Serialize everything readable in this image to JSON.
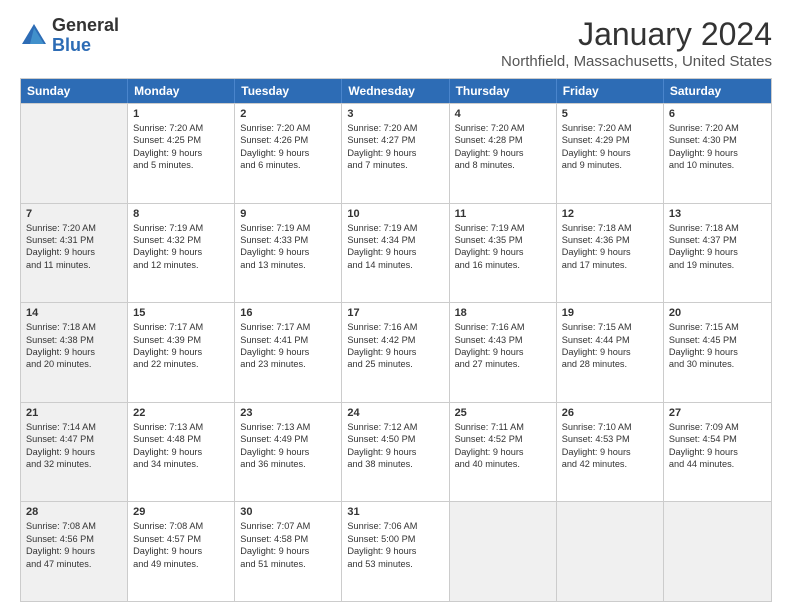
{
  "logo": {
    "general": "General",
    "blue": "Blue"
  },
  "title": {
    "month": "January 2024",
    "location": "Northfield, Massachusetts, United States"
  },
  "header_days": [
    "Sunday",
    "Monday",
    "Tuesday",
    "Wednesday",
    "Thursday",
    "Friday",
    "Saturday"
  ],
  "weeks": [
    [
      {
        "day": "",
        "lines": [],
        "shaded": true
      },
      {
        "day": "1",
        "lines": [
          "Sunrise: 7:20 AM",
          "Sunset: 4:25 PM",
          "Daylight: 9 hours",
          "and 5 minutes."
        ],
        "shaded": false
      },
      {
        "day": "2",
        "lines": [
          "Sunrise: 7:20 AM",
          "Sunset: 4:26 PM",
          "Daylight: 9 hours",
          "and 6 minutes."
        ],
        "shaded": false
      },
      {
        "day": "3",
        "lines": [
          "Sunrise: 7:20 AM",
          "Sunset: 4:27 PM",
          "Daylight: 9 hours",
          "and 7 minutes."
        ],
        "shaded": false
      },
      {
        "day": "4",
        "lines": [
          "Sunrise: 7:20 AM",
          "Sunset: 4:28 PM",
          "Daylight: 9 hours",
          "and 8 minutes."
        ],
        "shaded": false
      },
      {
        "day": "5",
        "lines": [
          "Sunrise: 7:20 AM",
          "Sunset: 4:29 PM",
          "Daylight: 9 hours",
          "and 9 minutes."
        ],
        "shaded": false
      },
      {
        "day": "6",
        "lines": [
          "Sunrise: 7:20 AM",
          "Sunset: 4:30 PM",
          "Daylight: 9 hours",
          "and 10 minutes."
        ],
        "shaded": false
      }
    ],
    [
      {
        "day": "7",
        "lines": [
          "Sunrise: 7:20 AM",
          "Sunset: 4:31 PM",
          "Daylight: 9 hours",
          "and 11 minutes."
        ],
        "shaded": true
      },
      {
        "day": "8",
        "lines": [
          "Sunrise: 7:19 AM",
          "Sunset: 4:32 PM",
          "Daylight: 9 hours",
          "and 12 minutes."
        ],
        "shaded": false
      },
      {
        "day": "9",
        "lines": [
          "Sunrise: 7:19 AM",
          "Sunset: 4:33 PM",
          "Daylight: 9 hours",
          "and 13 minutes."
        ],
        "shaded": false
      },
      {
        "day": "10",
        "lines": [
          "Sunrise: 7:19 AM",
          "Sunset: 4:34 PM",
          "Daylight: 9 hours",
          "and 14 minutes."
        ],
        "shaded": false
      },
      {
        "day": "11",
        "lines": [
          "Sunrise: 7:19 AM",
          "Sunset: 4:35 PM",
          "Daylight: 9 hours",
          "and 16 minutes."
        ],
        "shaded": false
      },
      {
        "day": "12",
        "lines": [
          "Sunrise: 7:18 AM",
          "Sunset: 4:36 PM",
          "Daylight: 9 hours",
          "and 17 minutes."
        ],
        "shaded": false
      },
      {
        "day": "13",
        "lines": [
          "Sunrise: 7:18 AM",
          "Sunset: 4:37 PM",
          "Daylight: 9 hours",
          "and 19 minutes."
        ],
        "shaded": false
      }
    ],
    [
      {
        "day": "14",
        "lines": [
          "Sunrise: 7:18 AM",
          "Sunset: 4:38 PM",
          "Daylight: 9 hours",
          "and 20 minutes."
        ],
        "shaded": true
      },
      {
        "day": "15",
        "lines": [
          "Sunrise: 7:17 AM",
          "Sunset: 4:39 PM",
          "Daylight: 9 hours",
          "and 22 minutes."
        ],
        "shaded": false
      },
      {
        "day": "16",
        "lines": [
          "Sunrise: 7:17 AM",
          "Sunset: 4:41 PM",
          "Daylight: 9 hours",
          "and 23 minutes."
        ],
        "shaded": false
      },
      {
        "day": "17",
        "lines": [
          "Sunrise: 7:16 AM",
          "Sunset: 4:42 PM",
          "Daylight: 9 hours",
          "and 25 minutes."
        ],
        "shaded": false
      },
      {
        "day": "18",
        "lines": [
          "Sunrise: 7:16 AM",
          "Sunset: 4:43 PM",
          "Daylight: 9 hours",
          "and 27 minutes."
        ],
        "shaded": false
      },
      {
        "day": "19",
        "lines": [
          "Sunrise: 7:15 AM",
          "Sunset: 4:44 PM",
          "Daylight: 9 hours",
          "and 28 minutes."
        ],
        "shaded": false
      },
      {
        "day": "20",
        "lines": [
          "Sunrise: 7:15 AM",
          "Sunset: 4:45 PM",
          "Daylight: 9 hours",
          "and 30 minutes."
        ],
        "shaded": false
      }
    ],
    [
      {
        "day": "21",
        "lines": [
          "Sunrise: 7:14 AM",
          "Sunset: 4:47 PM",
          "Daylight: 9 hours",
          "and 32 minutes."
        ],
        "shaded": true
      },
      {
        "day": "22",
        "lines": [
          "Sunrise: 7:13 AM",
          "Sunset: 4:48 PM",
          "Daylight: 9 hours",
          "and 34 minutes."
        ],
        "shaded": false
      },
      {
        "day": "23",
        "lines": [
          "Sunrise: 7:13 AM",
          "Sunset: 4:49 PM",
          "Daylight: 9 hours",
          "and 36 minutes."
        ],
        "shaded": false
      },
      {
        "day": "24",
        "lines": [
          "Sunrise: 7:12 AM",
          "Sunset: 4:50 PM",
          "Daylight: 9 hours",
          "and 38 minutes."
        ],
        "shaded": false
      },
      {
        "day": "25",
        "lines": [
          "Sunrise: 7:11 AM",
          "Sunset: 4:52 PM",
          "Daylight: 9 hours",
          "and 40 minutes."
        ],
        "shaded": false
      },
      {
        "day": "26",
        "lines": [
          "Sunrise: 7:10 AM",
          "Sunset: 4:53 PM",
          "Daylight: 9 hours",
          "and 42 minutes."
        ],
        "shaded": false
      },
      {
        "day": "27",
        "lines": [
          "Sunrise: 7:09 AM",
          "Sunset: 4:54 PM",
          "Daylight: 9 hours",
          "and 44 minutes."
        ],
        "shaded": false
      }
    ],
    [
      {
        "day": "28",
        "lines": [
          "Sunrise: 7:08 AM",
          "Sunset: 4:56 PM",
          "Daylight: 9 hours",
          "and 47 minutes."
        ],
        "shaded": true
      },
      {
        "day": "29",
        "lines": [
          "Sunrise: 7:08 AM",
          "Sunset: 4:57 PM",
          "Daylight: 9 hours",
          "and 49 minutes."
        ],
        "shaded": false
      },
      {
        "day": "30",
        "lines": [
          "Sunrise: 7:07 AM",
          "Sunset: 4:58 PM",
          "Daylight: 9 hours",
          "and 51 minutes."
        ],
        "shaded": false
      },
      {
        "day": "31",
        "lines": [
          "Sunrise: 7:06 AM",
          "Sunset: 5:00 PM",
          "Daylight: 9 hours",
          "and 53 minutes."
        ],
        "shaded": false
      },
      {
        "day": "",
        "lines": [],
        "shaded": true
      },
      {
        "day": "",
        "lines": [],
        "shaded": true
      },
      {
        "day": "",
        "lines": [],
        "shaded": true
      }
    ]
  ]
}
